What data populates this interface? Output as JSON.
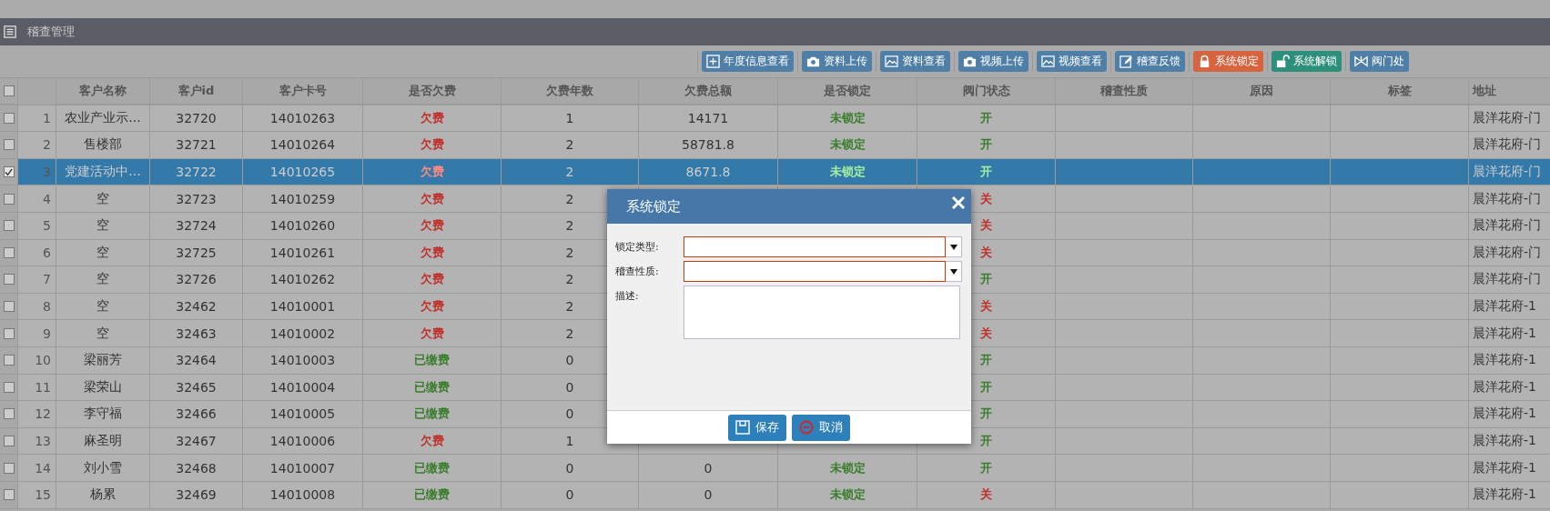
{
  "panel": {
    "title": "稽查管理"
  },
  "toolbar": [
    {
      "label": "年度信息查看",
      "kind": "plus",
      "color": "#4f7fa6"
    },
    {
      "label": "资料上传",
      "kind": "camera",
      "color": "#4f7fa6"
    },
    {
      "label": "资料查看",
      "kind": "image",
      "color": "#4f7fa6"
    },
    {
      "label": "视频上传",
      "kind": "camera",
      "color": "#4f7fa6"
    },
    {
      "label": "视频查看",
      "kind": "image",
      "color": "#4f7fa6"
    },
    {
      "label": "稽查反馈",
      "kind": "edit",
      "color": "#4f7fa6"
    },
    {
      "label": "系统锁定",
      "kind": "lock",
      "color": "#d5643f"
    },
    {
      "label": "系统解锁",
      "kind": "unlock",
      "color": "#2e8f7a"
    },
    {
      "label": "阀门处",
      "kind": "valve",
      "color": "#4f7fa6"
    }
  ],
  "table": {
    "all_checked": false,
    "columns": [
      "客户名称",
      "客户id",
      "客户卡号",
      "是否欠费",
      "欠费年数",
      "欠费总额",
      "是否锁定",
      "阀门状态",
      "稽查性质",
      "原因",
      "标签",
      "地址"
    ],
    "rows": [
      {
        "checked": false,
        "selected": false,
        "index": "1",
        "name": "农业产业示...",
        "id": "32720",
        "card": "14010263",
        "arrears": {
          "text": "欠费",
          "kind": "owed"
        },
        "years": "1",
        "amount": "14171",
        "lock": {
          "text": "未锁定",
          "kind": "unlocked"
        },
        "valve": {
          "text": "开",
          "open": true
        },
        "address": "晨洋花府-门"
      },
      {
        "checked": false,
        "selected": false,
        "index": "2",
        "name": "售楼部",
        "id": "32721",
        "card": "14010264",
        "arrears": {
          "text": "欠费",
          "kind": "owed"
        },
        "years": "2",
        "amount": "58781.8",
        "lock": {
          "text": "未锁定",
          "kind": "unlocked"
        },
        "valve": {
          "text": "开",
          "open": true
        },
        "address": "晨洋花府-门"
      },
      {
        "checked": true,
        "selected": true,
        "index": "3",
        "name": "党建活动中...",
        "id": "32722",
        "card": "14010265",
        "arrears": {
          "text": "欠费",
          "kind": "owed"
        },
        "years": "2",
        "amount": "8671.8",
        "lock": {
          "text": "未锁定",
          "kind": "unlocked"
        },
        "valve": {
          "text": "开",
          "open": true
        },
        "address": "晨洋花府-门"
      },
      {
        "checked": false,
        "selected": false,
        "index": "4",
        "name": "空",
        "id": "32723",
        "card": "14010259",
        "arrears": {
          "text": "欠费",
          "kind": "owed"
        },
        "years": "2",
        "valve": {
          "text": "关",
          "open": false
        },
        "address": "晨洋花府-门"
      },
      {
        "checked": false,
        "selected": false,
        "index": "5",
        "name": "空",
        "id": "32724",
        "card": "14010260",
        "arrears": {
          "text": "欠费",
          "kind": "owed"
        },
        "years": "2",
        "valve": {
          "text": "关",
          "open": false
        },
        "address": "晨洋花府-门"
      },
      {
        "checked": false,
        "selected": false,
        "index": "6",
        "name": "空",
        "id": "32725",
        "card": "14010261",
        "arrears": {
          "text": "欠费",
          "kind": "owed"
        },
        "years": "2",
        "valve": {
          "text": "关",
          "open": false
        },
        "address": "晨洋花府-门"
      },
      {
        "checked": false,
        "selected": false,
        "index": "7",
        "name": "空",
        "id": "32726",
        "card": "14010262",
        "arrears": {
          "text": "欠费",
          "kind": "owed"
        },
        "years": "2",
        "valve": {
          "text": "开",
          "open": true
        },
        "address": "晨洋花府-门"
      },
      {
        "checked": false,
        "selected": false,
        "index": "8",
        "name": "空",
        "id": "32462",
        "card": "14010001",
        "arrears": {
          "text": "欠费",
          "kind": "owed"
        },
        "years": "2",
        "valve": {
          "text": "关",
          "open": false
        },
        "address": "晨洋花府-1"
      },
      {
        "checked": false,
        "selected": false,
        "index": "9",
        "name": "空",
        "id": "32463",
        "card": "14010002",
        "arrears": {
          "text": "欠费",
          "kind": "owed"
        },
        "years": "2",
        "valve": {
          "text": "关",
          "open": false
        },
        "address": "晨洋花府-1"
      },
      {
        "checked": false,
        "selected": false,
        "index": "10",
        "name": "梁丽芳",
        "id": "32464",
        "card": "14010003",
        "arrears": {
          "text": "已缴费",
          "kind": "paid"
        },
        "years": "0",
        "valve": {
          "text": "开",
          "open": true
        },
        "address": "晨洋花府-1"
      },
      {
        "checked": false,
        "selected": false,
        "index": "11",
        "name": "梁荣山",
        "id": "32465",
        "card": "14010004",
        "arrears": {
          "text": "已缴费",
          "kind": "paid"
        },
        "years": "0",
        "valve": {
          "text": "开",
          "open": true
        },
        "address": "晨洋花府-1"
      },
      {
        "checked": false,
        "selected": false,
        "index": "12",
        "name": "李守福",
        "id": "32466",
        "card": "14010005",
        "arrears": {
          "text": "已缴费",
          "kind": "paid"
        },
        "years": "0",
        "valve": {
          "text": "开",
          "open": true
        },
        "address": "晨洋花府-1"
      },
      {
        "checked": false,
        "selected": false,
        "index": "13",
        "name": "麻圣明",
        "id": "32467",
        "card": "14010006",
        "arrears": {
          "text": "欠费",
          "kind": "owed"
        },
        "years": "1",
        "valve": {
          "text": "开",
          "open": true
        },
        "address": "晨洋花府-1"
      },
      {
        "checked": false,
        "selected": false,
        "index": "14",
        "name": "刘小雪",
        "id": "32468",
        "card": "14010007",
        "arrears": {
          "text": "已缴费",
          "kind": "paid"
        },
        "years": "0",
        "amount": "0",
        "lock": {
          "text": "未锁定",
          "kind": "unlocked"
        },
        "valve": {
          "text": "开",
          "open": true
        },
        "address": "晨洋花府-1"
      },
      {
        "checked": false,
        "selected": false,
        "index": "15",
        "name": "杨累",
        "id": "32469",
        "card": "14010008",
        "arrears": {
          "text": "已缴费",
          "kind": "paid"
        },
        "years": "0",
        "amount": "0",
        "lock": {
          "text": "未锁定",
          "kind": "unlocked"
        },
        "valve": {
          "text": "关",
          "open": false
        },
        "address": "晨洋花府-1"
      }
    ]
  },
  "dialog": {
    "title": "系统锁定",
    "fields": [
      {
        "label": "锁定类型:",
        "kind": "select",
        "invalid": true
      },
      {
        "label": "稽查性质:",
        "kind": "select",
        "invalid": true
      },
      {
        "label": "描述:",
        "kind": "textarea",
        "invalid": false
      }
    ],
    "buttons": [
      {
        "label": "保存",
        "kind": "save"
      },
      {
        "label": "取消",
        "kind": "cancel"
      }
    ]
  }
}
